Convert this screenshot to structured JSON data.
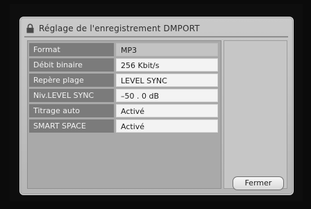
{
  "dialog": {
    "title": "Réglage de l'enregistrement DMPORT",
    "title_icon": "lock-icon"
  },
  "settings": [
    {
      "label": "Format",
      "value": "MP3"
    },
    {
      "label": "Débit binaire",
      "value": "256 Kbit/s"
    },
    {
      "label": "Repère plage",
      "value": "LEVEL SYNC"
    },
    {
      "label": "Niv.LEVEL SYNC",
      "value": "–50 . 0 dB"
    },
    {
      "label": "Titrage auto",
      "value": "Activé"
    },
    {
      "label": "SMART SPACE",
      "value": "Activé"
    }
  ],
  "buttons": {
    "close_label": "Fermer"
  }
}
